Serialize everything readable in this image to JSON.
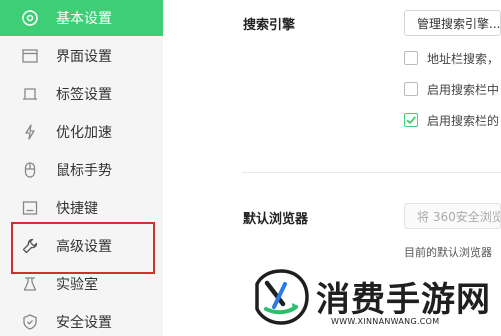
{
  "sidebar": {
    "items": [
      {
        "label": "基本设置",
        "icon": "settings-gear-icon",
        "active": true
      },
      {
        "label": "界面设置",
        "icon": "window-icon"
      },
      {
        "label": "标签设置",
        "icon": "tab-icon"
      },
      {
        "label": "优化加速",
        "icon": "lightning-icon"
      },
      {
        "label": "鼠标手势",
        "icon": "mouse-icon"
      },
      {
        "label": "快捷键",
        "icon": "keyboard-icon"
      },
      {
        "label": "高级设置",
        "icon": "wrench-icon",
        "highlighted": true
      },
      {
        "label": "实验室",
        "icon": "flask-icon"
      },
      {
        "label": "安全设置",
        "icon": "shield-icon"
      }
    ],
    "active_color": "#3ecf76",
    "highlight_color": "#d0312d"
  },
  "search_engine": {
    "label": "搜索引擎",
    "manage_button": "管理搜索引擎...",
    "options": [
      {
        "label": "地址栏搜索，",
        "checked": false
      },
      {
        "label": "启用搜索栏中",
        "checked": false
      },
      {
        "label": "启用搜索栏的",
        "checked": true
      }
    ]
  },
  "default_browser": {
    "label": "默认浏览器",
    "set_button": "将 360安全浏览",
    "note": "目前的默认浏览器"
  },
  "watermark": {
    "title": "消费手游网",
    "url": "WWW.XINNANWANG.COM"
  }
}
